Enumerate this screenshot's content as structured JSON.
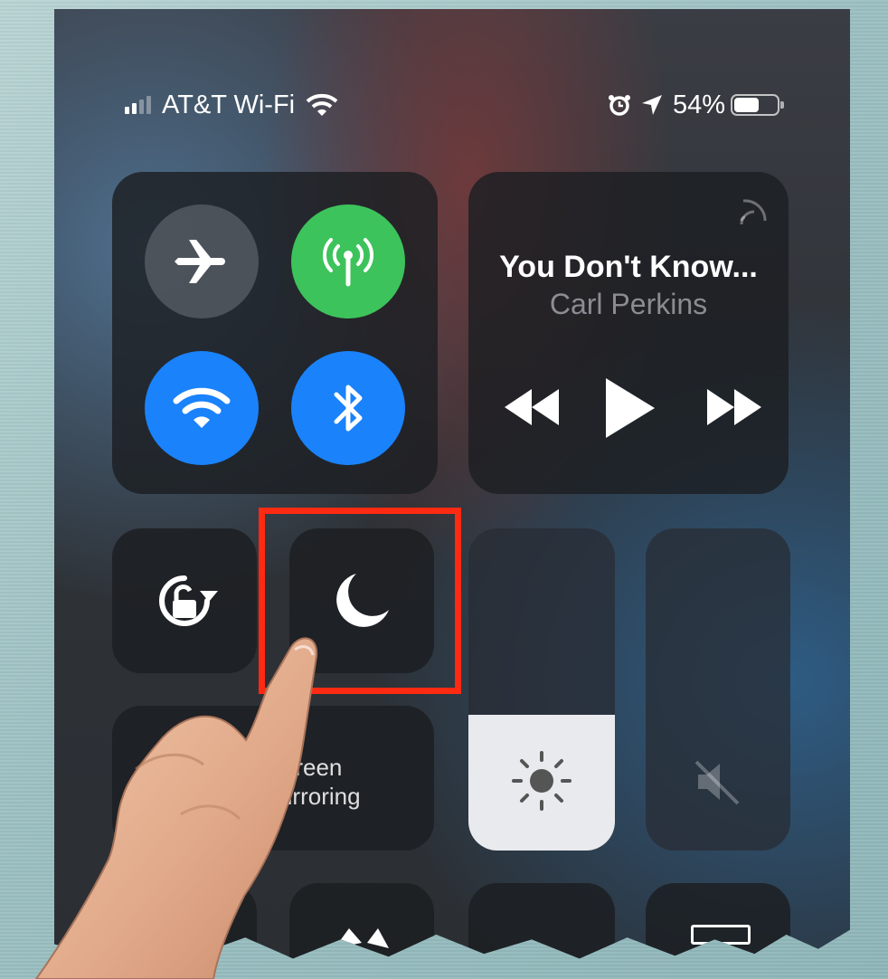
{
  "status_bar": {
    "carrier": "AT&T Wi-Fi",
    "battery": "54%",
    "icons": [
      "signal-bars-icon",
      "wifi-icon",
      "alarm-icon",
      "location-arrow-icon",
      "battery-icon"
    ]
  },
  "connectivity": {
    "airplane_mode": {
      "icon": "airplane-icon",
      "on": false
    },
    "cellular_data": {
      "icon": "antenna-icon",
      "on": true,
      "color": "#3dc35b"
    },
    "wifi": {
      "icon": "wifi-icon",
      "on": true,
      "color": "#1a82fb"
    },
    "bluetooth": {
      "icon": "bluetooth-icon",
      "on": true,
      "color": "#1a82fb"
    }
  },
  "now_playing": {
    "title": "You Don't Know...",
    "artist": "Carl Perkins",
    "controls": [
      "rewind-icon",
      "play-icon",
      "fast-forward-icon"
    ]
  },
  "controls": {
    "orientation_lock": {
      "icon": "rotation-lock-icon"
    },
    "do_not_disturb": {
      "icon": "moon-icon",
      "highlighted": true,
      "highlight_color": "#ff2a12"
    },
    "screen_mirroring": {
      "label_line1": "Screen",
      "label_line2": "Mirroring"
    }
  },
  "sliders": {
    "brightness": {
      "level": 0.42,
      "icon": "sun-icon"
    },
    "volume": {
      "level": 0.0,
      "icon": "speaker-muted-icon"
    }
  }
}
